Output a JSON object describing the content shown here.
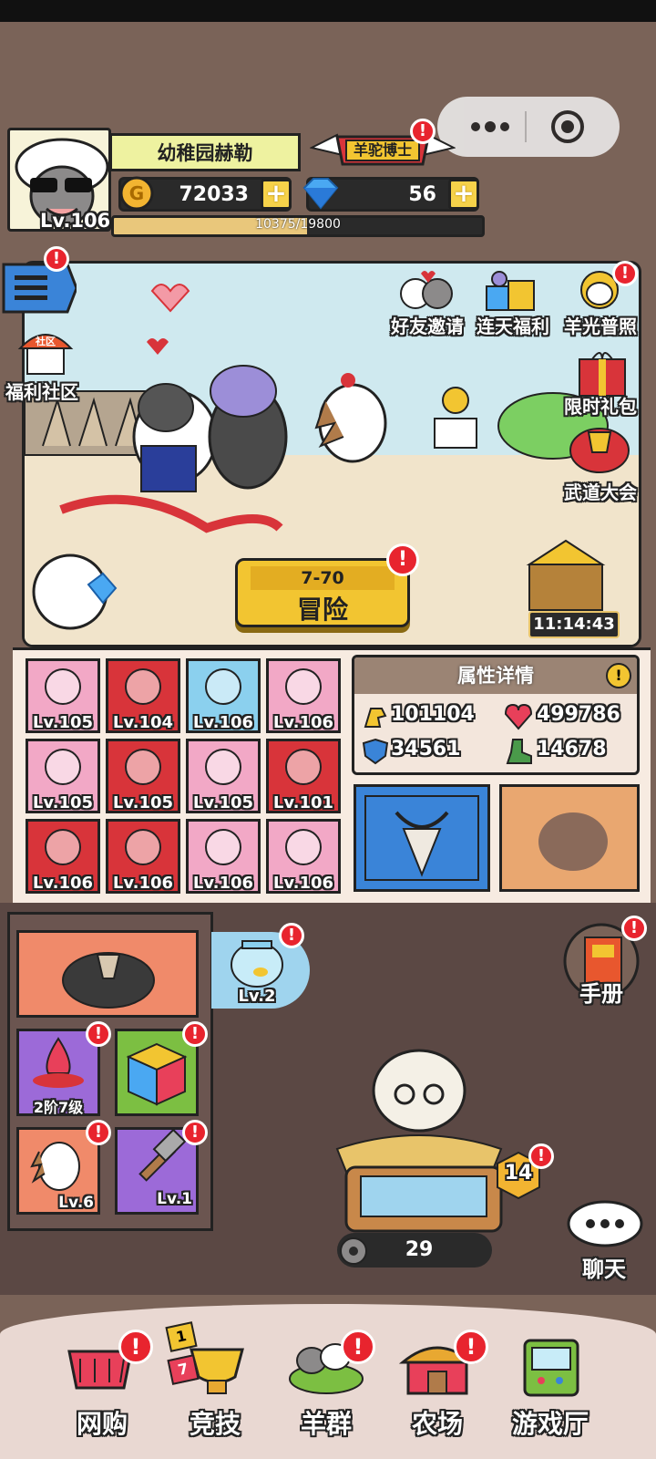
{
  "player": {
    "level": "Lv.106",
    "name": "幼稚园赫勒",
    "title": "羊驼博士",
    "gold": "72033",
    "diamonds": "56",
    "exp_text": "10375/19800",
    "exp_fraction": 0.524
  },
  "scene_buttons": {
    "friend_invite": "好友邀请",
    "daily_welfare": "连天福利",
    "sheep_photo": "羊光普照",
    "welfare_community": "福利社区",
    "community_sign": "社区",
    "limited_gift": "限时礼包",
    "martial_arts": "武道大会"
  },
  "adventure": {
    "stage": "7-70",
    "label": "冒险"
  },
  "chest_timer": "11:14:43",
  "equipment": [
    {
      "name": "wizard-hat",
      "level": "Lv.105",
      "bg": "#f2a8c6"
    },
    {
      "name": "blue-bird",
      "level": "Lv.104",
      "bg": "#d8343a"
    },
    {
      "name": "pelican",
      "level": "Lv.106",
      "bg": "#8bd0ee"
    },
    {
      "name": "drum",
      "level": "Lv.106",
      "bg": "#f2a8c6"
    },
    {
      "name": "cat-plush",
      "level": "Lv.105",
      "bg": "#f2a8c6"
    },
    {
      "name": "straw-hat-table",
      "level": "Lv.105",
      "bg": "#d8343a"
    },
    {
      "name": "flower-pot",
      "level": "Lv.105",
      "bg": "#f2a8c6"
    },
    {
      "name": "bonsai",
      "level": "Lv.101",
      "bg": "#d8343a"
    },
    {
      "name": "cabbage",
      "level": "Lv.106",
      "bg": "#d8343a"
    },
    {
      "name": "wooden-desk",
      "level": "Lv.106",
      "bg": "#d8343a"
    },
    {
      "name": "pitchfork",
      "level": "Lv.106",
      "bg": "#f2a8c6"
    },
    {
      "name": "fence",
      "level": "Lv.106",
      "bg": "#f2a8c6"
    }
  ],
  "attributes": {
    "header": "属性详情",
    "attack": "101104",
    "hp": "499786",
    "defense": "34561",
    "speed": "14678"
  },
  "lower": {
    "fishbowl_level": "Lv.2",
    "handbook": "手册",
    "tier_label": "2阶7级",
    "hedgehog_level": "Lv.6",
    "hammer_level": "Lv.1",
    "hay_count": "29",
    "pen_level": "14",
    "chat": "聊天"
  },
  "nav": {
    "shop": "网购",
    "arena": "竞技",
    "flock": "羊群",
    "farm": "农场",
    "arcade": "游戏厅",
    "arena_badge_1": "1",
    "arena_badge_2": "7"
  },
  "colors": {
    "accent_yellow": "#f2c531",
    "alert_red": "#e8242e",
    "panel_brown": "#7a6358"
  }
}
